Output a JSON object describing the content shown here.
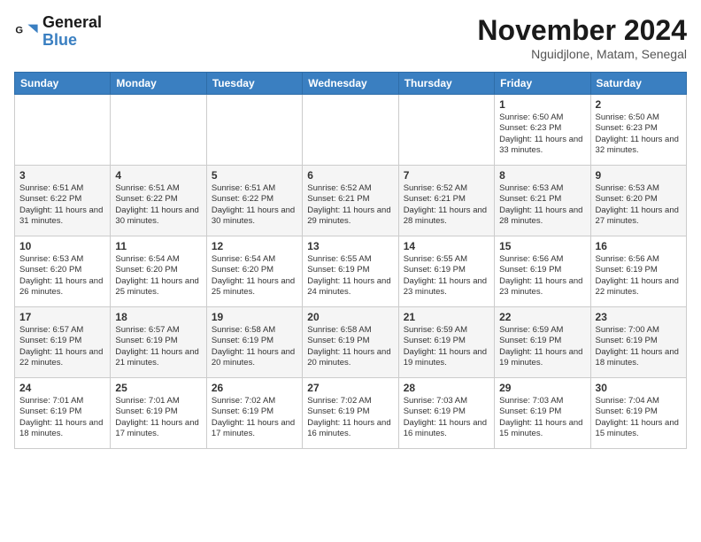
{
  "logo": {
    "line1": "General",
    "line2": "Blue"
  },
  "title": "November 2024",
  "subtitle": "Nguidjlone, Matam, Senegal",
  "days_of_week": [
    "Sunday",
    "Monday",
    "Tuesday",
    "Wednesday",
    "Thursday",
    "Friday",
    "Saturday"
  ],
  "weeks": [
    [
      {
        "day": "",
        "info": ""
      },
      {
        "day": "",
        "info": ""
      },
      {
        "day": "",
        "info": ""
      },
      {
        "day": "",
        "info": ""
      },
      {
        "day": "",
        "info": ""
      },
      {
        "day": "1",
        "info": "Sunrise: 6:50 AM\nSunset: 6:23 PM\nDaylight: 11 hours and 33 minutes."
      },
      {
        "day": "2",
        "info": "Sunrise: 6:50 AM\nSunset: 6:23 PM\nDaylight: 11 hours and 32 minutes."
      }
    ],
    [
      {
        "day": "3",
        "info": "Sunrise: 6:51 AM\nSunset: 6:22 PM\nDaylight: 11 hours and 31 minutes."
      },
      {
        "day": "4",
        "info": "Sunrise: 6:51 AM\nSunset: 6:22 PM\nDaylight: 11 hours and 30 minutes."
      },
      {
        "day": "5",
        "info": "Sunrise: 6:51 AM\nSunset: 6:22 PM\nDaylight: 11 hours and 30 minutes."
      },
      {
        "day": "6",
        "info": "Sunrise: 6:52 AM\nSunset: 6:21 PM\nDaylight: 11 hours and 29 minutes."
      },
      {
        "day": "7",
        "info": "Sunrise: 6:52 AM\nSunset: 6:21 PM\nDaylight: 11 hours and 28 minutes."
      },
      {
        "day": "8",
        "info": "Sunrise: 6:53 AM\nSunset: 6:21 PM\nDaylight: 11 hours and 28 minutes."
      },
      {
        "day": "9",
        "info": "Sunrise: 6:53 AM\nSunset: 6:20 PM\nDaylight: 11 hours and 27 minutes."
      }
    ],
    [
      {
        "day": "10",
        "info": "Sunrise: 6:53 AM\nSunset: 6:20 PM\nDaylight: 11 hours and 26 minutes."
      },
      {
        "day": "11",
        "info": "Sunrise: 6:54 AM\nSunset: 6:20 PM\nDaylight: 11 hours and 25 minutes."
      },
      {
        "day": "12",
        "info": "Sunrise: 6:54 AM\nSunset: 6:20 PM\nDaylight: 11 hours and 25 minutes."
      },
      {
        "day": "13",
        "info": "Sunrise: 6:55 AM\nSunset: 6:19 PM\nDaylight: 11 hours and 24 minutes."
      },
      {
        "day": "14",
        "info": "Sunrise: 6:55 AM\nSunset: 6:19 PM\nDaylight: 11 hours and 23 minutes."
      },
      {
        "day": "15",
        "info": "Sunrise: 6:56 AM\nSunset: 6:19 PM\nDaylight: 11 hours and 23 minutes."
      },
      {
        "day": "16",
        "info": "Sunrise: 6:56 AM\nSunset: 6:19 PM\nDaylight: 11 hours and 22 minutes."
      }
    ],
    [
      {
        "day": "17",
        "info": "Sunrise: 6:57 AM\nSunset: 6:19 PM\nDaylight: 11 hours and 22 minutes."
      },
      {
        "day": "18",
        "info": "Sunrise: 6:57 AM\nSunset: 6:19 PM\nDaylight: 11 hours and 21 minutes."
      },
      {
        "day": "19",
        "info": "Sunrise: 6:58 AM\nSunset: 6:19 PM\nDaylight: 11 hours and 20 minutes."
      },
      {
        "day": "20",
        "info": "Sunrise: 6:58 AM\nSunset: 6:19 PM\nDaylight: 11 hours and 20 minutes."
      },
      {
        "day": "21",
        "info": "Sunrise: 6:59 AM\nSunset: 6:19 PM\nDaylight: 11 hours and 19 minutes."
      },
      {
        "day": "22",
        "info": "Sunrise: 6:59 AM\nSunset: 6:19 PM\nDaylight: 11 hours and 19 minutes."
      },
      {
        "day": "23",
        "info": "Sunrise: 7:00 AM\nSunset: 6:19 PM\nDaylight: 11 hours and 18 minutes."
      }
    ],
    [
      {
        "day": "24",
        "info": "Sunrise: 7:01 AM\nSunset: 6:19 PM\nDaylight: 11 hours and 18 minutes."
      },
      {
        "day": "25",
        "info": "Sunrise: 7:01 AM\nSunset: 6:19 PM\nDaylight: 11 hours and 17 minutes."
      },
      {
        "day": "26",
        "info": "Sunrise: 7:02 AM\nSunset: 6:19 PM\nDaylight: 11 hours and 17 minutes."
      },
      {
        "day": "27",
        "info": "Sunrise: 7:02 AM\nSunset: 6:19 PM\nDaylight: 11 hours and 16 minutes."
      },
      {
        "day": "28",
        "info": "Sunrise: 7:03 AM\nSunset: 6:19 PM\nDaylight: 11 hours and 16 minutes."
      },
      {
        "day": "29",
        "info": "Sunrise: 7:03 AM\nSunset: 6:19 PM\nDaylight: 11 hours and 15 minutes."
      },
      {
        "day": "30",
        "info": "Sunrise: 7:04 AM\nSunset: 6:19 PM\nDaylight: 11 hours and 15 minutes."
      }
    ]
  ]
}
